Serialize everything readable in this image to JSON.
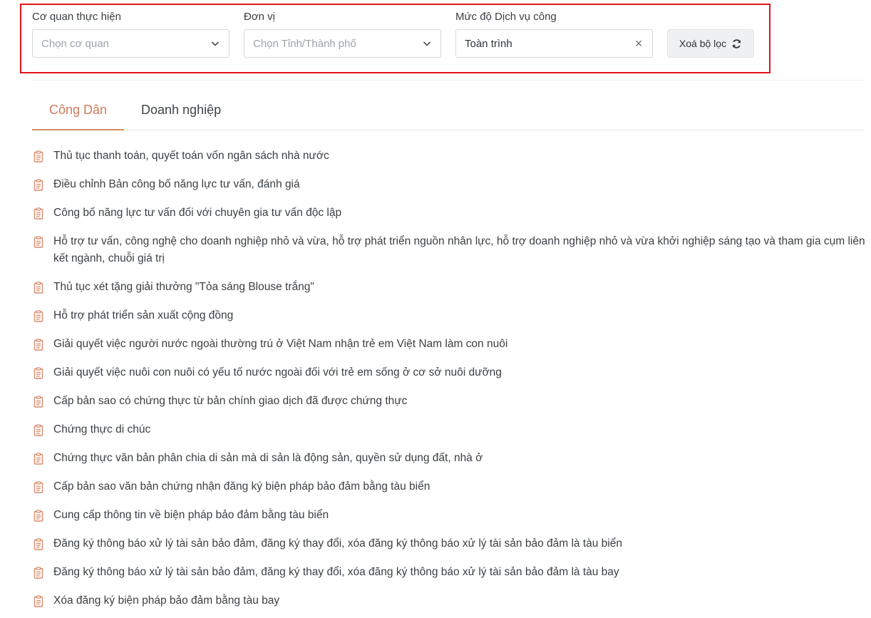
{
  "filters": {
    "agency": {
      "label": "Cơ quan thực hiện",
      "placeholder": "Chọn cơ quan"
    },
    "unit": {
      "label": "Đơn vị",
      "placeholder": "Chọn Tỉnh/Thành phố"
    },
    "service_level": {
      "label": "Mức độ Dịch vụ công",
      "value": "Toàn trình"
    },
    "reset_label": "Xoá bộ lọc"
  },
  "tabs": [
    {
      "label": "Công Dân",
      "active": true
    },
    {
      "label": "Doanh nghiệp",
      "active": false
    }
  ],
  "procedures": [
    "Thủ tục thanh toán, quyết toán vốn ngân sách nhà nước",
    "Điều chỉnh Bản công bố năng lực tư vấn, đánh giá",
    "Công bố năng lực tư vấn đối với chuyên gia tư vấn độc lập",
    "Hỗ trợ tư vấn, công nghệ cho doanh nghiệp nhỏ và vừa, hỗ trợ phát triển nguồn nhân lực, hỗ trợ doanh nghiệp nhỏ và vừa khởi nghiệp sáng tạo và tham gia cụm liên kết ngành, chuỗi giá trị",
    "Thủ tục xét tặng giải thưởng \"Tỏa sáng Blouse trắng\"",
    "Hỗ trợ phát triển sản xuất cộng đồng",
    "Giải quyết việc người nước ngoài thường trú ở Việt Nam nhận trẻ em Việt Nam làm con nuôi",
    "Giải quyết việc nuôi con nuôi có yếu tố nước ngoài đối với trẻ em sống ở cơ sở nuôi dưỡng",
    "Cấp bản sao có chứng thực từ bản chính giao dịch đã được chứng thực",
    "Chứng thực di chúc",
    "Chứng thực văn bản phân chia di sản mà di sản là động sản, quyền sử dụng đất, nhà ở",
    "Cấp bản sao văn bản chứng nhận đăng ký biện pháp bảo đảm bằng tàu biển",
    "Cung cấp thông tin về biện pháp bảo đảm bằng tàu biển",
    "Đăng ký thông báo xử lý tài sản bảo đảm, đăng ký thay đổi, xóa đăng ký thông báo xử lý tài sản bảo đảm là tàu biển",
    "Đăng ký thông báo xử lý tài sản bảo đảm, đăng ký thay đổi, xóa đăng ký thông báo xử lý tài sản bảo đảm là tàu bay",
    "Xóa đăng ký biện pháp bảo đảm bằng tàu bay"
  ],
  "colors": {
    "accent": "#cf7a5c",
    "highlight_border": "#e3131b"
  },
  "icons": {
    "list_item": "document-icon",
    "select": "chevron-down-icon",
    "clear": "close-icon",
    "reset": "refresh-icon"
  }
}
